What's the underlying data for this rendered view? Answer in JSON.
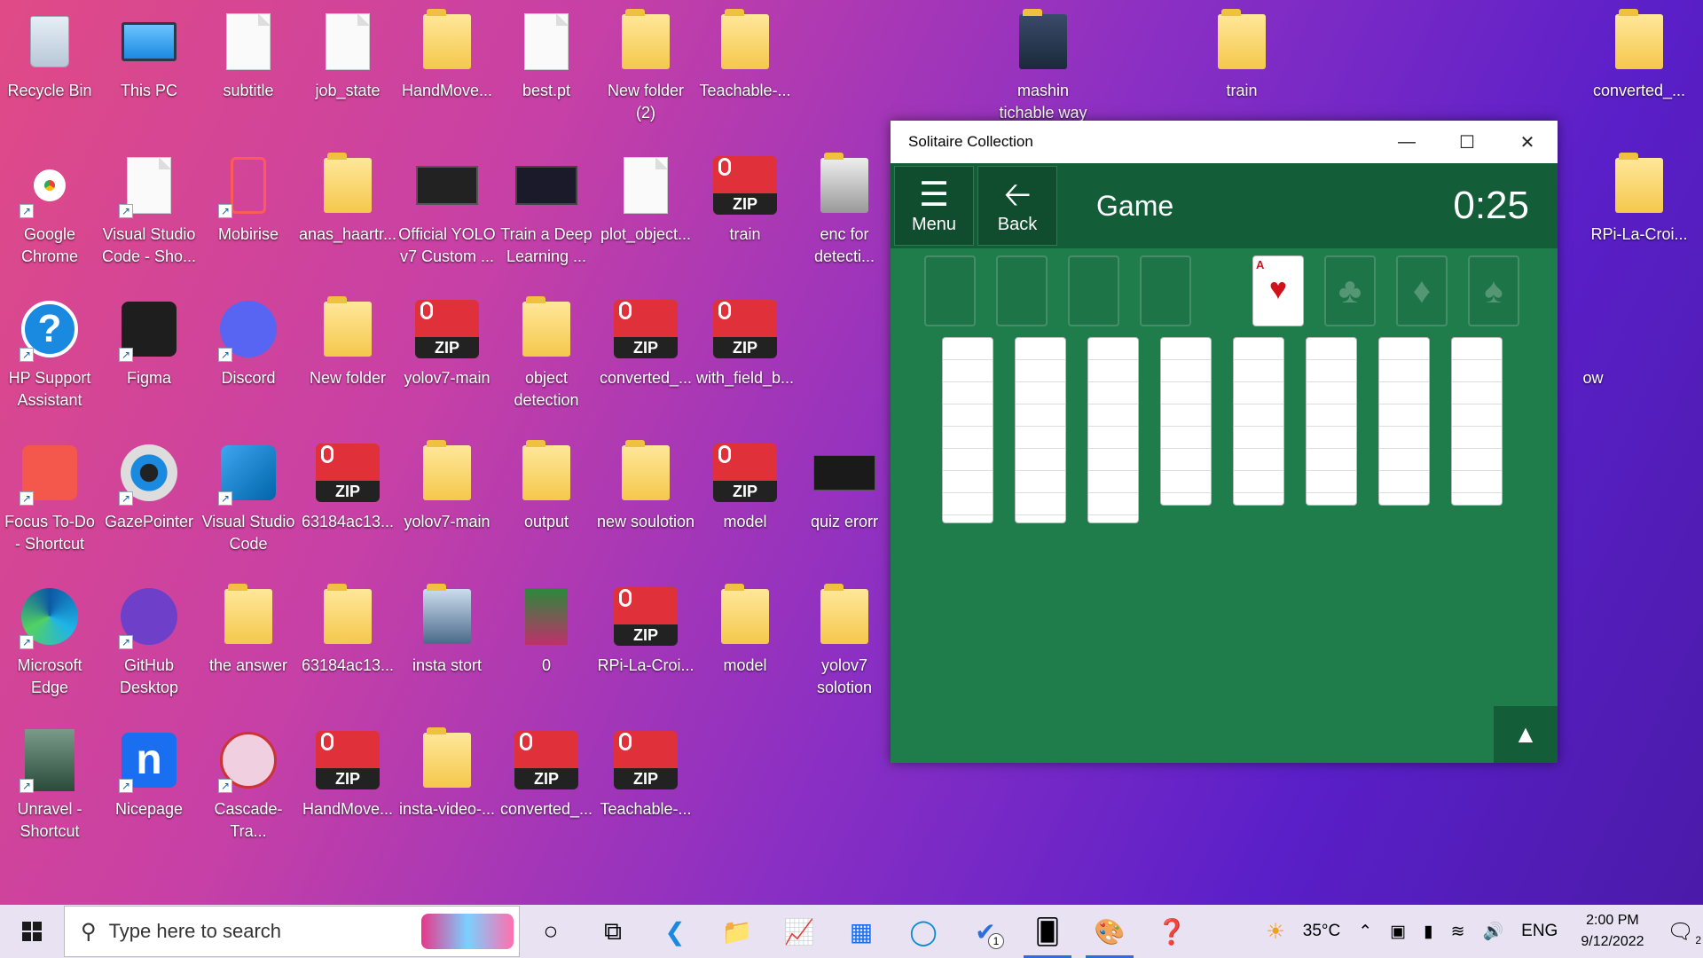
{
  "desktop": {
    "icons": [
      {
        "label": "Recycle Bin",
        "icon": "recycle-bin-icon"
      },
      {
        "label": "This PC",
        "icon": "computer-icon"
      },
      {
        "label": "subtitle",
        "icon": "python-file-icon"
      },
      {
        "label": "job_state",
        "icon": "file-icon"
      },
      {
        "label": "HandMove...",
        "icon": "folder-icon"
      },
      {
        "label": "best.pt",
        "icon": "file-icon"
      },
      {
        "label": "New folder (2)",
        "icon": "folder-icon"
      },
      {
        "label": "Teachable-...",
        "icon": "folder-icon"
      },
      {
        "label": "mashin tichable way",
        "icon": "folder-icon"
      },
      {
        "label": "train",
        "icon": "folder-icon"
      },
      {
        "label": "converted_...",
        "icon": "folder-icon"
      },
      {
        "label": "Google Chrome",
        "icon": "chrome-icon"
      },
      {
        "label": "Visual Studio Code - Sho...",
        "icon": "file-icon"
      },
      {
        "label": "Mobirise",
        "icon": "mobirise-icon"
      },
      {
        "label": "anas_haartr...",
        "icon": "folder-icon"
      },
      {
        "label": "Official YOLO v7 Custom ...",
        "icon": "video-icon"
      },
      {
        "label": "Train a Deep Learning ...",
        "icon": "video-icon"
      },
      {
        "label": "plot_object...",
        "icon": "python-file-icon"
      },
      {
        "label": "train",
        "icon": "zip-icon"
      },
      {
        "label": "enc for detecti...",
        "icon": "folder-icon"
      },
      {
        "label": "RPi-La-Croi...",
        "icon": "folder-icon"
      },
      {
        "label": "HP Support Assistant",
        "icon": "help-icon"
      },
      {
        "label": "Figma",
        "icon": "figma-icon"
      },
      {
        "label": "Discord",
        "icon": "discord-icon"
      },
      {
        "label": "New folder",
        "icon": "folder-icon"
      },
      {
        "label": "yolov7-main",
        "icon": "zip-icon"
      },
      {
        "label": "object detection",
        "icon": "folder-icon"
      },
      {
        "label": "converted_...",
        "icon": "zip-icon"
      },
      {
        "label": "with_field_b...",
        "icon": "zip-icon"
      },
      {
        "label": "ow",
        "icon": "none"
      },
      {
        "label": "Focus To-Do - Shortcut",
        "icon": "focus-todo-icon"
      },
      {
        "label": "GazePointer",
        "icon": "eye-icon"
      },
      {
        "label": "Visual Studio Code",
        "icon": "vscode-icon"
      },
      {
        "label": "63184ac13...",
        "icon": "zip-icon"
      },
      {
        "label": "yolov7-main",
        "icon": "folder-icon"
      },
      {
        "label": "output",
        "icon": "folder-icon"
      },
      {
        "label": "new soulotion",
        "icon": "folder-icon"
      },
      {
        "label": "model",
        "icon": "zip-icon"
      },
      {
        "label": "quiz erorr",
        "icon": "image-icon"
      },
      {
        "label": "Microsoft Edge",
        "icon": "edge-icon"
      },
      {
        "label": "GitHub Desktop",
        "icon": "github-icon"
      },
      {
        "label": "the answer",
        "icon": "folder-icon"
      },
      {
        "label": "63184ac13...",
        "icon": "folder-icon"
      },
      {
        "label": "insta stort",
        "icon": "folder-icon"
      },
      {
        "label": "0",
        "icon": "image-icon"
      },
      {
        "label": "RPi-La-Croi...",
        "icon": "zip-icon"
      },
      {
        "label": "model",
        "icon": "folder-icon"
      },
      {
        "label": "yolov7 solotion",
        "icon": "folder-icon"
      },
      {
        "label": "Unravel - Shortcut",
        "icon": "game-icon"
      },
      {
        "label": "Nicepage",
        "icon": "nicepage-icon"
      },
      {
        "label": "Cascade-Tra...",
        "icon": "flask-icon"
      },
      {
        "label": "HandMove...",
        "icon": "zip-icon"
      },
      {
        "label": "insta-video-...",
        "icon": "folder-icon"
      },
      {
        "label": "converted_...",
        "icon": "zip-icon"
      },
      {
        "label": "Teachable-...",
        "icon": "zip-icon"
      }
    ]
  },
  "window": {
    "title": "Solitaire Collection",
    "menu_label": "Menu",
    "back_label": "Back",
    "game_title": "Game",
    "timer": "0:25",
    "foundation_card": "A",
    "foundation_suits": [
      "♣",
      "♦",
      "♠"
    ]
  },
  "taskbar": {
    "search_placeholder": "Type here to search",
    "temperature": "35°C",
    "language": "ENG",
    "time": "2:00 PM",
    "date": "9/12/2022",
    "notification_count": "2",
    "todo_badge": "1"
  },
  "colors": {
    "felt": "#1f7d4c",
    "header": "#135e38",
    "accent": "#2a6fdb"
  }
}
